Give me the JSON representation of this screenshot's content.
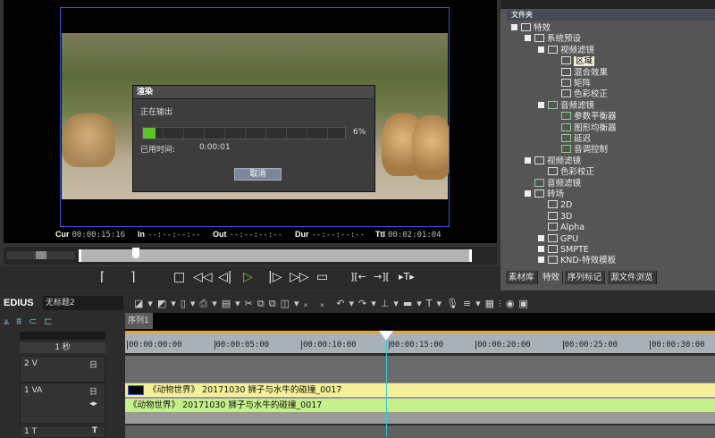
{
  "player": {
    "cur_label": "Cur",
    "cur": "00:00:15:16",
    "in_label": "In",
    "in": "--:--:--:--",
    "out_label": "Out",
    "out": "--:--:--:--",
    "dur_label": "Dur",
    "dur": "--:--:--:--",
    "ttl_label": "Ttl",
    "ttl": "00:02:01:04"
  },
  "render_dialog": {
    "title": "渲染",
    "status": "正在输出",
    "progress_percent": 6,
    "progress_label": "6%",
    "elapsed_label": "已用时间:",
    "elapsed": "0:00:01",
    "cancel": "取消",
    "accent": "#5ec22a"
  },
  "right_panel": {
    "header": "文件夹",
    "tree": [
      {
        "label": "特效",
        "level": 0,
        "pm": true,
        "green": false
      },
      {
        "label": "系统预设",
        "level": 1,
        "pm": true,
        "green": false
      },
      {
        "label": "视频滤镜",
        "level": 2,
        "pm": true,
        "green": false
      },
      {
        "label": "区域",
        "level": 3,
        "pm": false,
        "green": false,
        "selected": true
      },
      {
        "label": "混合效果",
        "level": 3,
        "pm": false,
        "green": false
      },
      {
        "label": "矩阵",
        "level": 3,
        "pm": false,
        "green": false
      },
      {
        "label": "色彩校正",
        "level": 3,
        "pm": false,
        "green": false
      },
      {
        "label": "音频滤镜",
        "level": 2,
        "pm": true,
        "green": true
      },
      {
        "label": "参数平衡器",
        "level": 3,
        "pm": false,
        "green": true
      },
      {
        "label": "图形均衡器",
        "level": 3,
        "pm": false,
        "green": true
      },
      {
        "label": "延迟",
        "level": 3,
        "pm": false,
        "green": true
      },
      {
        "label": "音调控制",
        "level": 3,
        "pm": false,
        "green": true
      },
      {
        "label": "视频滤镜",
        "level": 1,
        "pm": true,
        "green": false
      },
      {
        "label": "色彩校正",
        "level": 2,
        "pm": false,
        "green": false
      },
      {
        "label": "音频滤镜",
        "level": 1,
        "pm": false,
        "green": true
      },
      {
        "label": "转场",
        "level": 1,
        "pm": true,
        "green": false
      },
      {
        "label": "2D",
        "level": 2,
        "pm": false,
        "green": false
      },
      {
        "label": "3D",
        "level": 2,
        "pm": false,
        "green": false
      },
      {
        "label": "Alpha",
        "level": 2,
        "pm": false,
        "green": false
      },
      {
        "label": "GPU",
        "level": 2,
        "pm": true,
        "green": false
      },
      {
        "label": "SMPTE",
        "level": 2,
        "pm": true,
        "green": false
      },
      {
        "label": "KND-特效模板",
        "level": 2,
        "pm": true,
        "green": false
      }
    ],
    "tabs": [
      "素材库",
      "特效",
      "序列标记",
      "源文件浏览"
    ],
    "active_tab": 1
  },
  "timeline": {
    "app": "EDIUS",
    "project": "无标题2",
    "sequence_tab": "序列1",
    "scale": "1 秒",
    "ruler": [
      "00:00:00:00",
      "00:00:05:00",
      "00:00:10:00",
      "00:00:15:00",
      "00:00:20:00",
      "00:00:25:00",
      "00:00:30:00"
    ],
    "tracks": [
      {
        "name": "2 V"
      },
      {
        "name": "1 VA"
      },
      {
        "name": "1 T"
      }
    ],
    "video_clip": "《动物世界》 20171030 狮子与水牛的碰撞_0017",
    "audio_clip": "《动物世界》 20171030 狮子与水牛的碰撞_0017",
    "video_clip_color": "#f6ef9a",
    "audio_clip_color": "#c6f08a"
  }
}
